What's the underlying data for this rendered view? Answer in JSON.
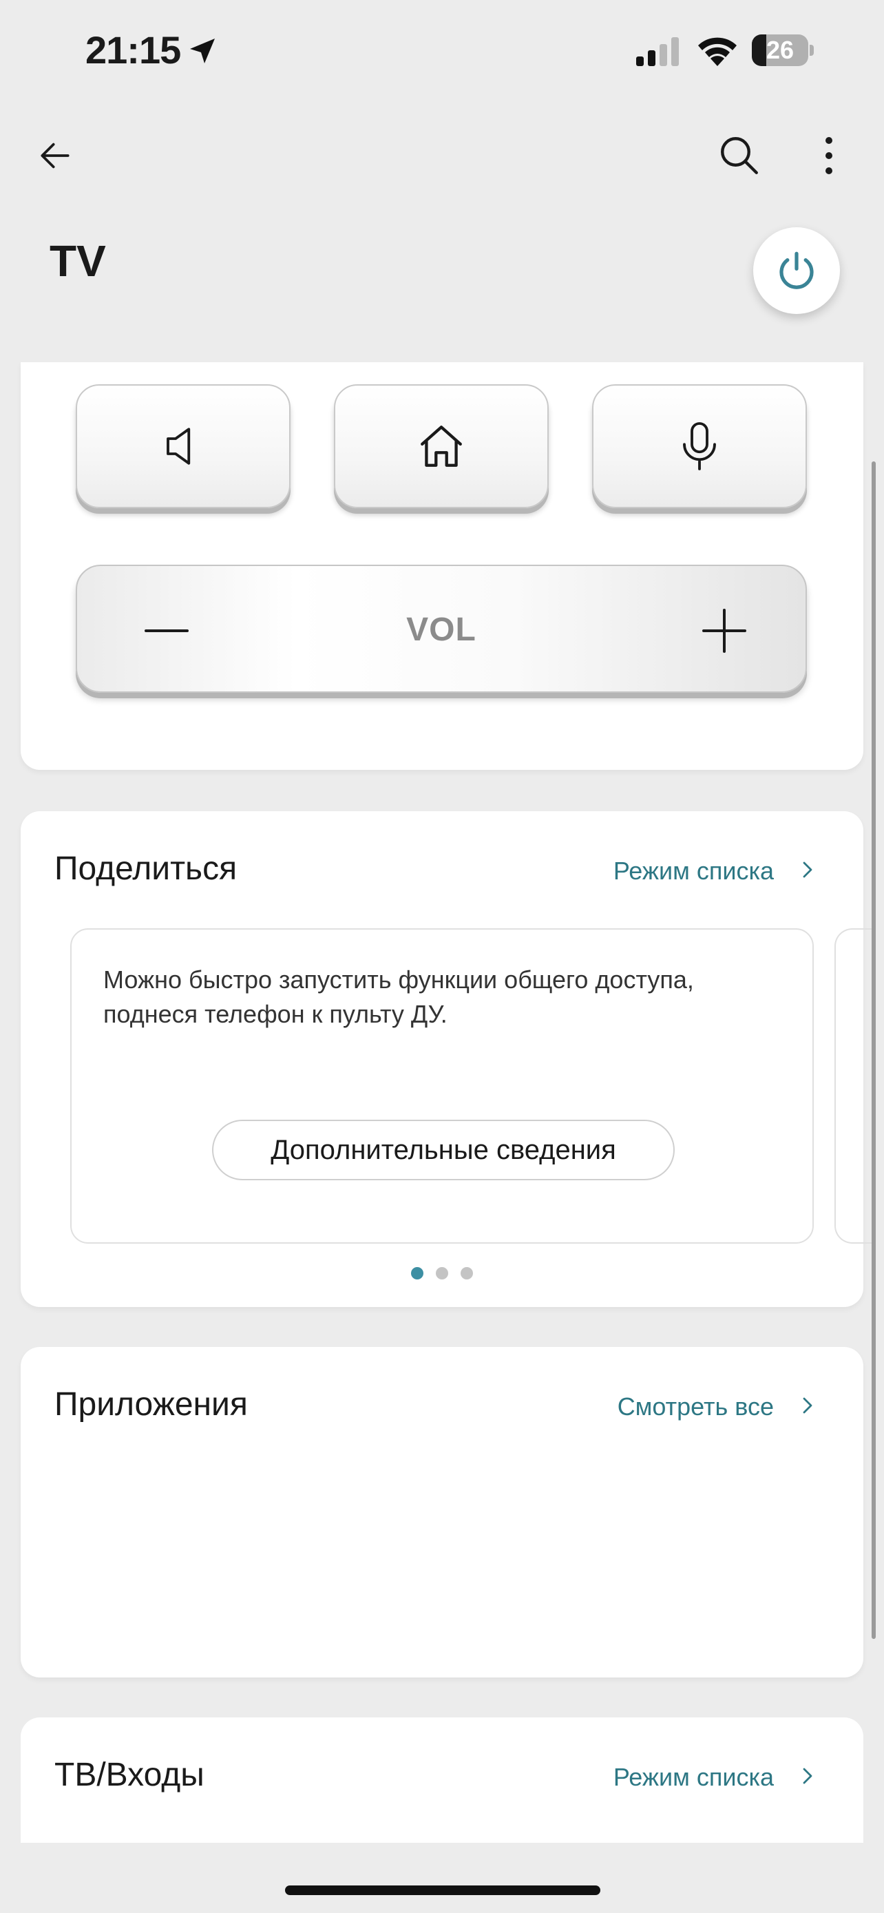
{
  "status_bar": {
    "time": "21:15",
    "battery": "26",
    "battery_level_percent": 26,
    "icons": [
      "location-arrow-icon",
      "cellular-signal-icon",
      "wifi-icon",
      "battery-icon"
    ]
  },
  "app_bar": {
    "title": "TV",
    "icons": [
      "back-arrow-icon",
      "search-icon",
      "more-vertical-icon",
      "power-icon"
    ]
  },
  "remote": {
    "buttons": [
      "speaker-mute-icon",
      "home-icon",
      "microphone-icon"
    ],
    "volume_label": "VOL",
    "volume_icons": [
      "minus-icon",
      "plus-icon"
    ]
  },
  "share": {
    "title": "Поделиться",
    "link": "Режим списка",
    "description": "Можно быстро запустить функции общего доступа, поднеся телефон к пульту ДУ.",
    "button": "Дополнительные сведения",
    "page_count": 3,
    "active_page": 1
  },
  "apps": {
    "title": "Приложения",
    "link": "Смотреть все"
  },
  "inputs": {
    "title": "ТВ/Входы",
    "link": "Режим списка"
  },
  "colors": {
    "accent": "#2d7784",
    "power_icon": "#3a8496",
    "dot_active": "#3d8fa3",
    "background": "#ececec",
    "card": "#ffffff"
  }
}
